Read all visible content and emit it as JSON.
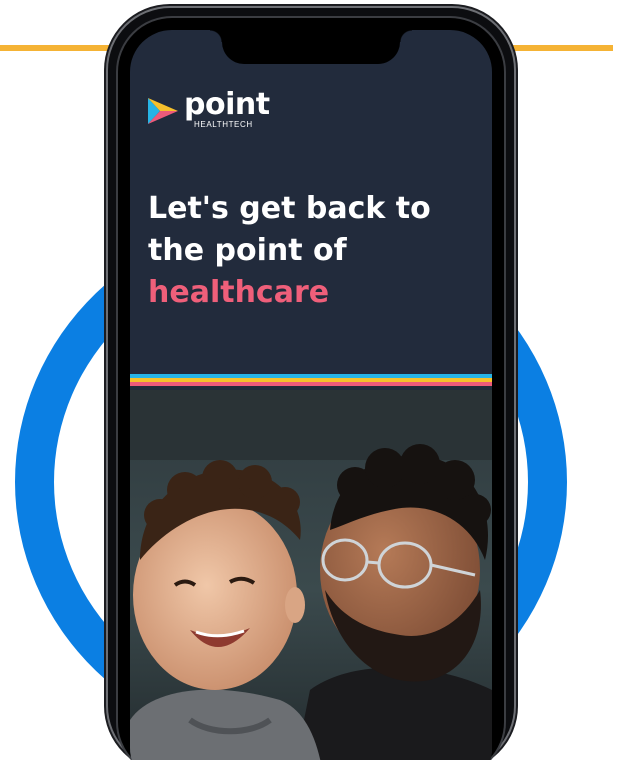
{
  "brand": {
    "name": "point",
    "tagline": "HEALTHTECH",
    "colors": {
      "accent_pink": "#ef5f7a",
      "blue_ring": "#0b7fe3",
      "orange_line": "#f5b335",
      "screen_bg": "#222b3c",
      "stripe_blue": "#27b4e6",
      "stripe_yellow": "#f6c02c",
      "stripe_pink": "#ee5a7a"
    }
  },
  "hero": {
    "line1": "Let's get back to",
    "line2": "the point of",
    "line3": "healthcare"
  },
  "icons": {
    "logo": "play-triangle-logo-icon"
  }
}
